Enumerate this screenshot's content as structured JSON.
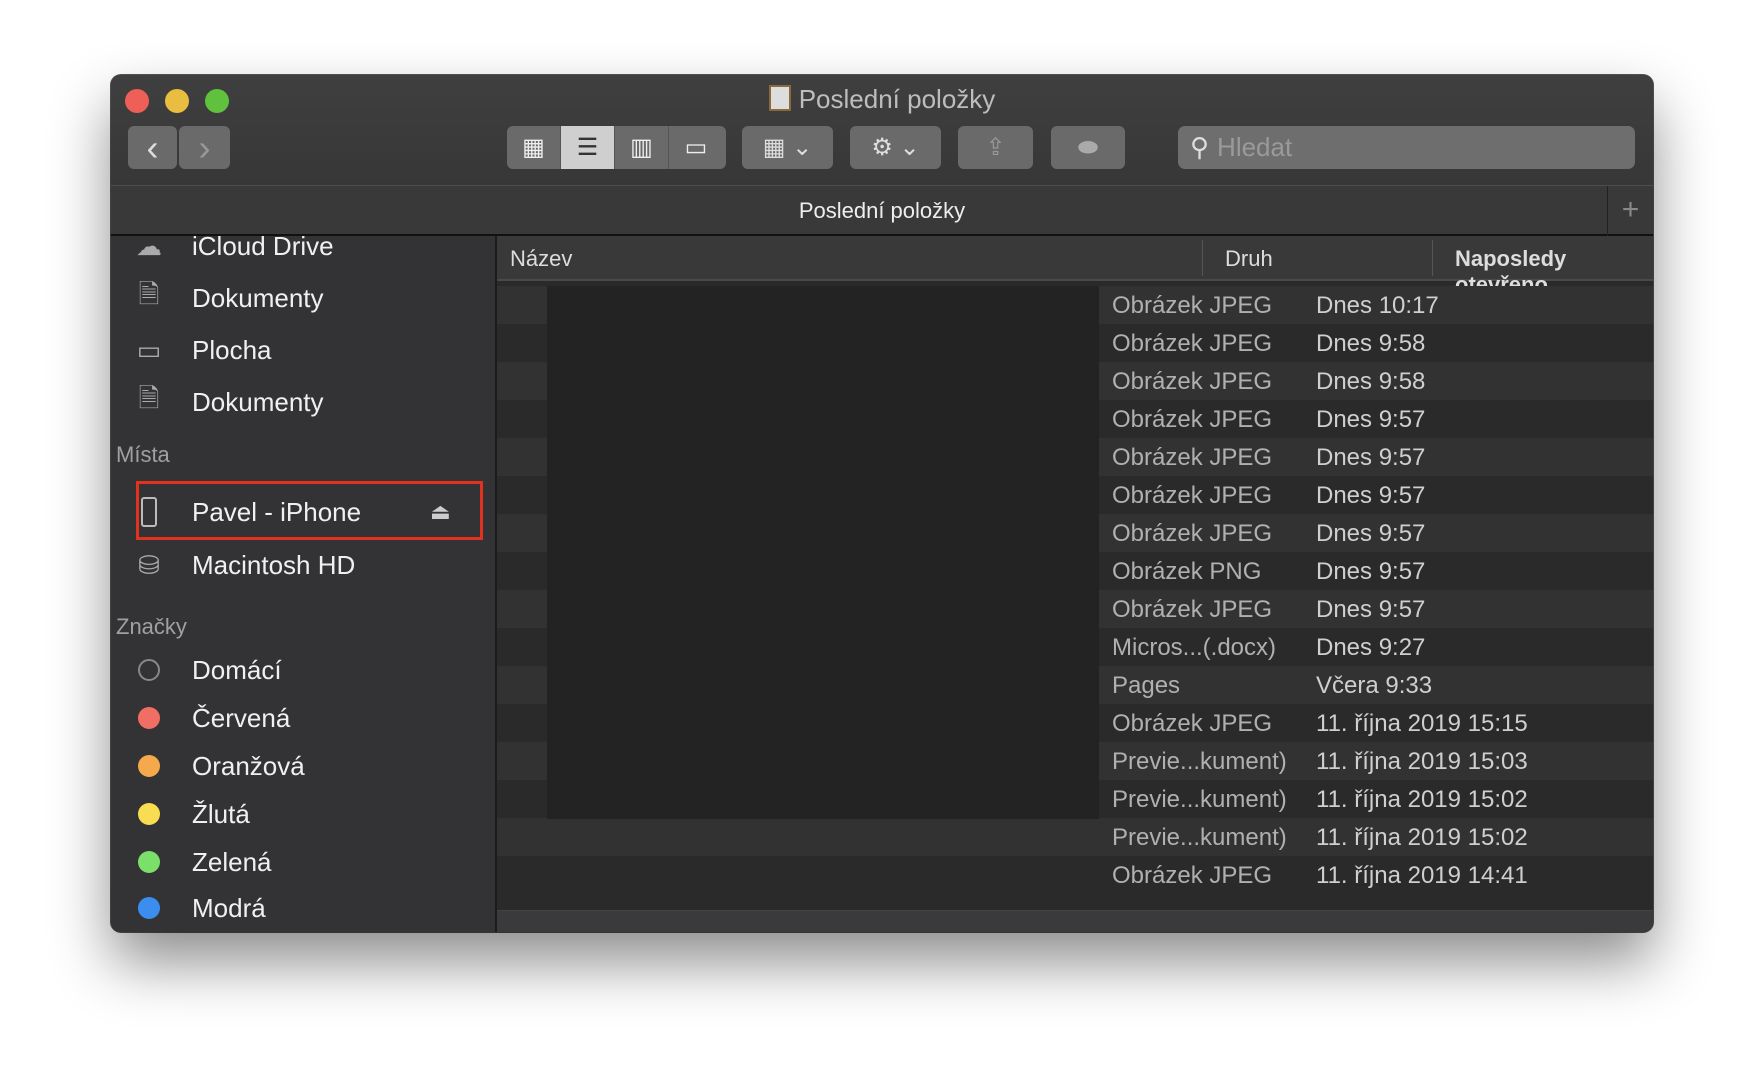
{
  "window": {
    "title": "Poslední položky",
    "path_title": "Poslední položky"
  },
  "toolbar": {
    "back": "‹",
    "forward": "›",
    "search_placeholder": "Hledat"
  },
  "sidebar": {
    "top_items": [
      {
        "label": "iCloud Drive",
        "icon": "cloud-icon"
      },
      {
        "label": "Dokumenty",
        "icon": "document-icon"
      },
      {
        "label": "Plocha",
        "icon": "desktop-icon"
      },
      {
        "label": "Dokumenty",
        "icon": "document-icon"
      }
    ],
    "places_heading": "Místa",
    "places": [
      {
        "label": "Pavel - iPhone",
        "icon": "iphone-icon"
      },
      {
        "label": "Macintosh HD",
        "icon": "hard-drive-icon"
      }
    ],
    "tags_heading": "Značky",
    "tags": [
      {
        "label": "Domácí",
        "color": ""
      },
      {
        "label": "Červená",
        "color": "#f16e65"
      },
      {
        "label": "Oranžová",
        "color": "#f5a94d"
      },
      {
        "label": "Žlutá",
        "color": "#f8dc52"
      },
      {
        "label": "Zelená",
        "color": "#7be06a"
      },
      {
        "label": "Modrá",
        "color": "#3b8df0"
      }
    ]
  },
  "table": {
    "columns": [
      "Název",
      "Druh",
      "Naposledy otevřeno"
    ],
    "rows": [
      {
        "kind": "Obrázek JPEG",
        "date": "Dnes 10:17"
      },
      {
        "kind": "Obrázek JPEG",
        "date": "Dnes 9:58"
      },
      {
        "kind": "Obrázek JPEG",
        "date": "Dnes 9:58"
      },
      {
        "kind": "Obrázek JPEG",
        "date": "Dnes 9:57"
      },
      {
        "kind": "Obrázek JPEG",
        "date": "Dnes 9:57"
      },
      {
        "kind": "Obrázek JPEG",
        "date": "Dnes 9:57"
      },
      {
        "kind": "Obrázek JPEG",
        "date": "Dnes 9:57"
      },
      {
        "kind": "Obrázek PNG",
        "date": "Dnes 9:57"
      },
      {
        "kind": "Obrázek JPEG",
        "date": "Dnes 9:57"
      },
      {
        "kind": "Micros...(.docx)",
        "date": "Dnes 9:27"
      },
      {
        "kind": "Pages",
        "date": "Včera 9:33"
      },
      {
        "kind": "Obrázek JPEG",
        "date": "11. října 2019 15:15"
      },
      {
        "kind": "Previe...kument)",
        "date": "11. října 2019 15:03"
      },
      {
        "kind": "Previe...kument)",
        "date": "11. října 2019 15:02"
      },
      {
        "kind": "Previe...kument)",
        "date": "11. října 2019 15:02"
      },
      {
        "kind": "Obrázek JPEG",
        "date": "11. října 2019 14:41"
      }
    ]
  }
}
